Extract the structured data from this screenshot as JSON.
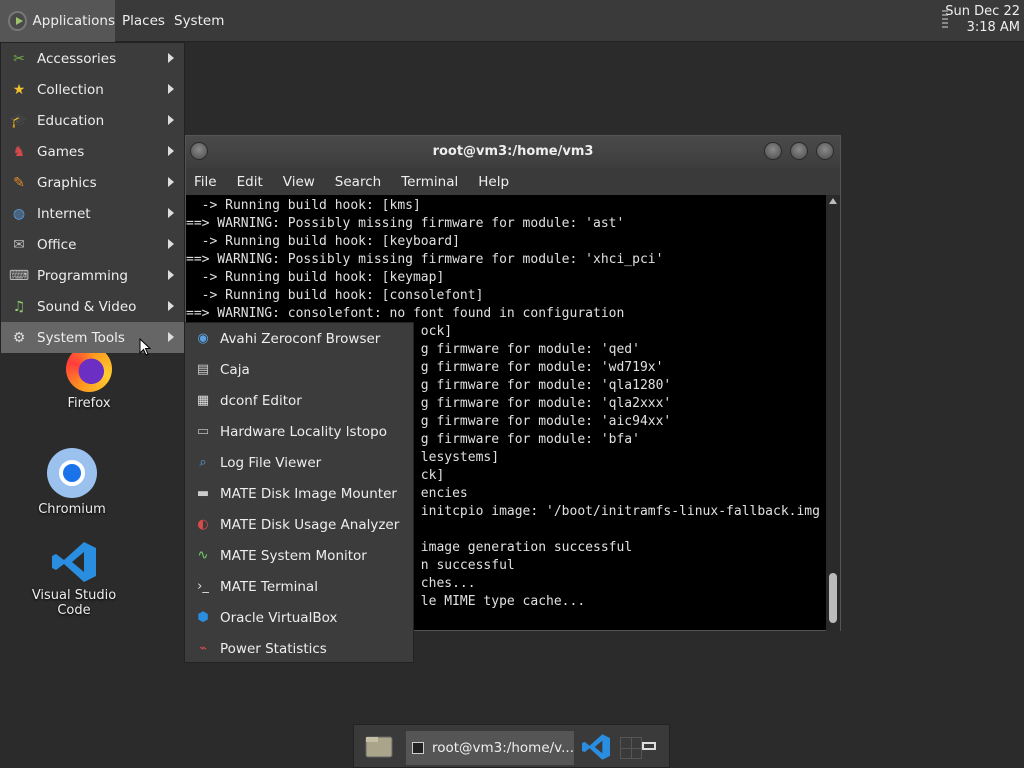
{
  "top_panel": {
    "applications": "Applications",
    "places": "Places",
    "system": "System",
    "clock_date": "Sun Dec 22",
    "clock_time": "3:18 AM"
  },
  "desktop_icons": {
    "firefox": "Firefox",
    "chromium": "Chromium",
    "vscode": "Visual Studio Code"
  },
  "app_menu": {
    "items": [
      {
        "label": "Accessories",
        "icon": "accessories-icon"
      },
      {
        "label": "Collection",
        "icon": "star-icon"
      },
      {
        "label": "Education",
        "icon": "education-icon"
      },
      {
        "label": "Games",
        "icon": "games-icon"
      },
      {
        "label": "Graphics",
        "icon": "graphics-icon"
      },
      {
        "label": "Internet",
        "icon": "globe-icon"
      },
      {
        "label": "Office",
        "icon": "office-icon"
      },
      {
        "label": "Programming",
        "icon": "programming-icon"
      },
      {
        "label": "Sound & Video",
        "icon": "sound-video-icon"
      },
      {
        "label": "System Tools",
        "icon": "gear-icon"
      }
    ]
  },
  "system_tools_submenu": {
    "items": [
      {
        "label": "Avahi Zeroconf Browser",
        "icon": "avahi-icon"
      },
      {
        "label": "Caja",
        "icon": "caja-icon"
      },
      {
        "label": "dconf Editor",
        "icon": "dconf-icon"
      },
      {
        "label": "Hardware Locality lstopo",
        "icon": "hardware-icon"
      },
      {
        "label": "Log File Viewer",
        "icon": "log-viewer-icon"
      },
      {
        "label": "MATE Disk Image Mounter",
        "icon": "disk-mounter-icon"
      },
      {
        "label": "MATE Disk Usage Analyzer",
        "icon": "disk-usage-icon"
      },
      {
        "label": "MATE System Monitor",
        "icon": "system-monitor-icon"
      },
      {
        "label": "MATE Terminal",
        "icon": "terminal-icon"
      },
      {
        "label": "Oracle VirtualBox",
        "icon": "virtualbox-icon"
      },
      {
        "label": "Power Statistics",
        "icon": "power-stats-icon"
      }
    ]
  },
  "terminal": {
    "title": "root@vm3:/home/vm3",
    "menu": [
      "File",
      "Edit",
      "View",
      "Search",
      "Terminal",
      "Help"
    ],
    "lines": [
      "  -> Running build hook: [kms]",
      "==> WARNING: Possibly missing firmware for module: 'ast'",
      "  -> Running build hook: [keyboard]",
      "==> WARNING: Possibly missing firmware for module: 'xhci_pci'",
      "  -> Running build hook: [keymap]",
      "  -> Running build hook: [consolefont]",
      "==> WARNING: consolefont: no font found in configuration",
      "                              ock]",
      "                              g firmware for module: 'qed'",
      "                              g firmware for module: 'wd719x'",
      "                              g firmware for module: 'qla1280'",
      "                              g firmware for module: 'qla2xxx'",
      "                              g firmware for module: 'aic94xx'",
      "                              g firmware for module: 'bfa'",
      "                              lesystems]",
      "                              ck]",
      "                              encies",
      "                              initcpio image: '/boot/initramfs-linux-fallback.img",
      "",
      "                              image generation successful",
      "                              n successful",
      "                              ches...",
      "                              le MIME type cache..."
    ]
  },
  "taskbar": {
    "terminal_task": "root@vm3:/home/v..."
  }
}
